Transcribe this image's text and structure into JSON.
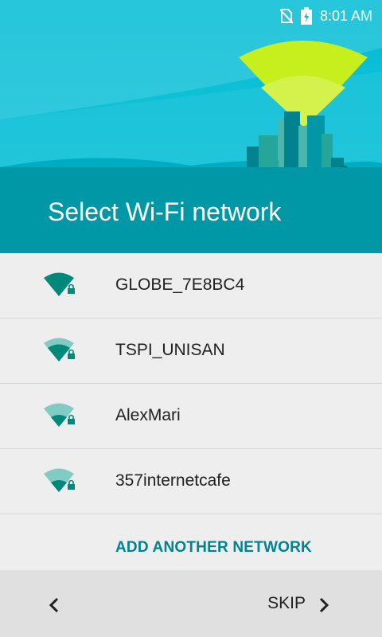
{
  "status": {
    "time": "8:01 AM",
    "icons": [
      "no-sim-icon",
      "battery-charging-icon"
    ]
  },
  "header": {
    "title": "Select Wi-Fi network"
  },
  "networks": [
    {
      "ssid": "GLOBE_7E8BC4",
      "signal": 4,
      "secured": true
    },
    {
      "ssid": "TSPI_UNISAN",
      "signal": 3,
      "secured": true
    },
    {
      "ssid": "AlexMari",
      "signal": 2,
      "secured": true
    },
    {
      "ssid": "357internetcafe",
      "signal": 2,
      "secured": true
    }
  ],
  "actions": {
    "add_network": "ADD ANOTHER NETWORK",
    "skip": "SKIP"
  },
  "colors": {
    "header": "#00BCD4",
    "header_dark": "#0097A7",
    "accent": "#00838F",
    "wifi_strong": "#00897B",
    "wifi_weak": "#80CBC4"
  }
}
